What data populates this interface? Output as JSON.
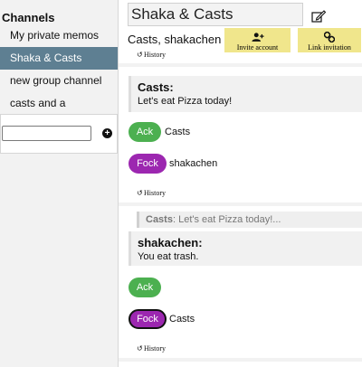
{
  "sidebar": {
    "heading": "Channels",
    "items": [
      {
        "label": "My private memos"
      },
      {
        "label": "Shaka & Casts"
      },
      {
        "label": "new group channel"
      },
      {
        "label": "casts and a"
      }
    ],
    "new_channel_input": {
      "value": "",
      "placeholder": ""
    }
  },
  "header": {
    "channel_title": "Shaka & Casts",
    "members": "Casts, shakachen",
    "invite_label": "Invite account",
    "link_label": "Link invitation"
  },
  "history_label": "History",
  "messages": [
    {
      "author": "Casts:",
      "text": "Let's eat Pizza today!",
      "reactions": [
        {
          "label": "Ack",
          "who": "Casts"
        },
        {
          "label": "Fock",
          "who": "shakachen"
        }
      ]
    },
    {
      "quote_author": "Casts",
      "quote_text": ": Let's eat Pizza today!...",
      "author": "shakachen:",
      "text": "You eat trash.",
      "reactions": [
        {
          "label": "Ack",
          "who": ""
        },
        {
          "label": "Fock",
          "who": "Casts"
        }
      ]
    }
  ],
  "colors": {
    "active_channel": "#5e7f92",
    "ack": "#4cb050",
    "fock": "#9c27b0",
    "action_button": "#f0e68c"
  },
  "icons": {
    "edit": "edit-pencil-icon",
    "invite": "add-user-icon",
    "link": "link-icon",
    "history": "history-icon",
    "add": "plus-circle-icon"
  }
}
